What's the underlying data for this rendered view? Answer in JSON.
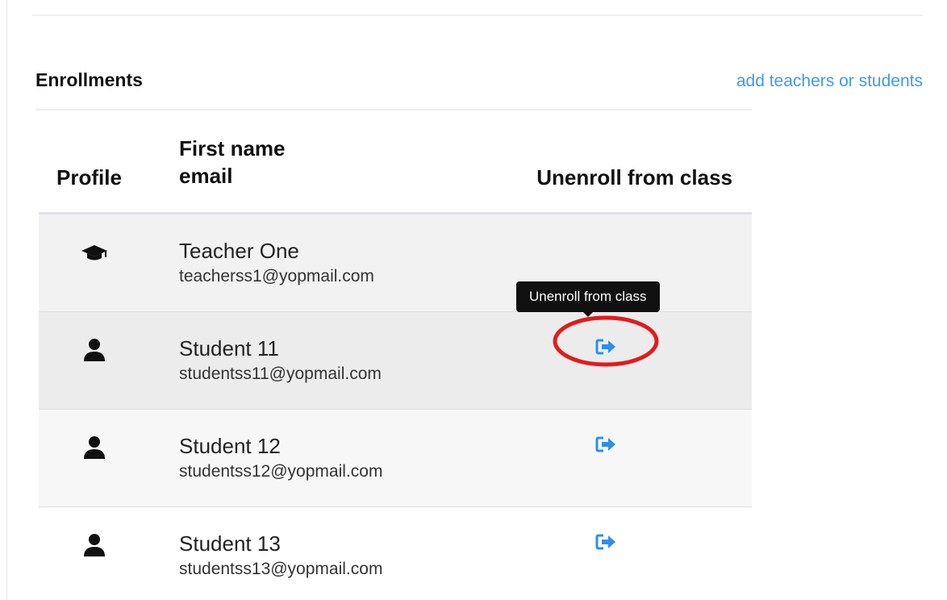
{
  "enrollments": {
    "title": "Enrollments",
    "add_link": "add teachers or students",
    "columns": {
      "profile": "Profile",
      "name_line1": "First name",
      "name_line2": "email",
      "unenroll": "Unenroll from class"
    },
    "rows": [
      {
        "icon": "graduation-cap-icon",
        "name": "Teacher One",
        "email": "teacherss1@yopmail.com",
        "can_unenroll": false
      },
      {
        "icon": "user-icon",
        "name": "Student 11",
        "email": "studentss11@yopmail.com",
        "can_unenroll": true
      },
      {
        "icon": "user-icon",
        "name": "Student 12",
        "email": "studentss12@yopmail.com",
        "can_unenroll": true
      },
      {
        "icon": "user-icon",
        "name": "Student 13",
        "email": "studentss13@yopmail.com",
        "can_unenroll": true
      }
    ],
    "tooltip": "Unenroll from class"
  },
  "colors": {
    "link": "#3d9be9",
    "unenroll_icon": "#2f8fe6",
    "annotation_ring": "#e31b1b",
    "tooltip_bg": "#111111"
  }
}
